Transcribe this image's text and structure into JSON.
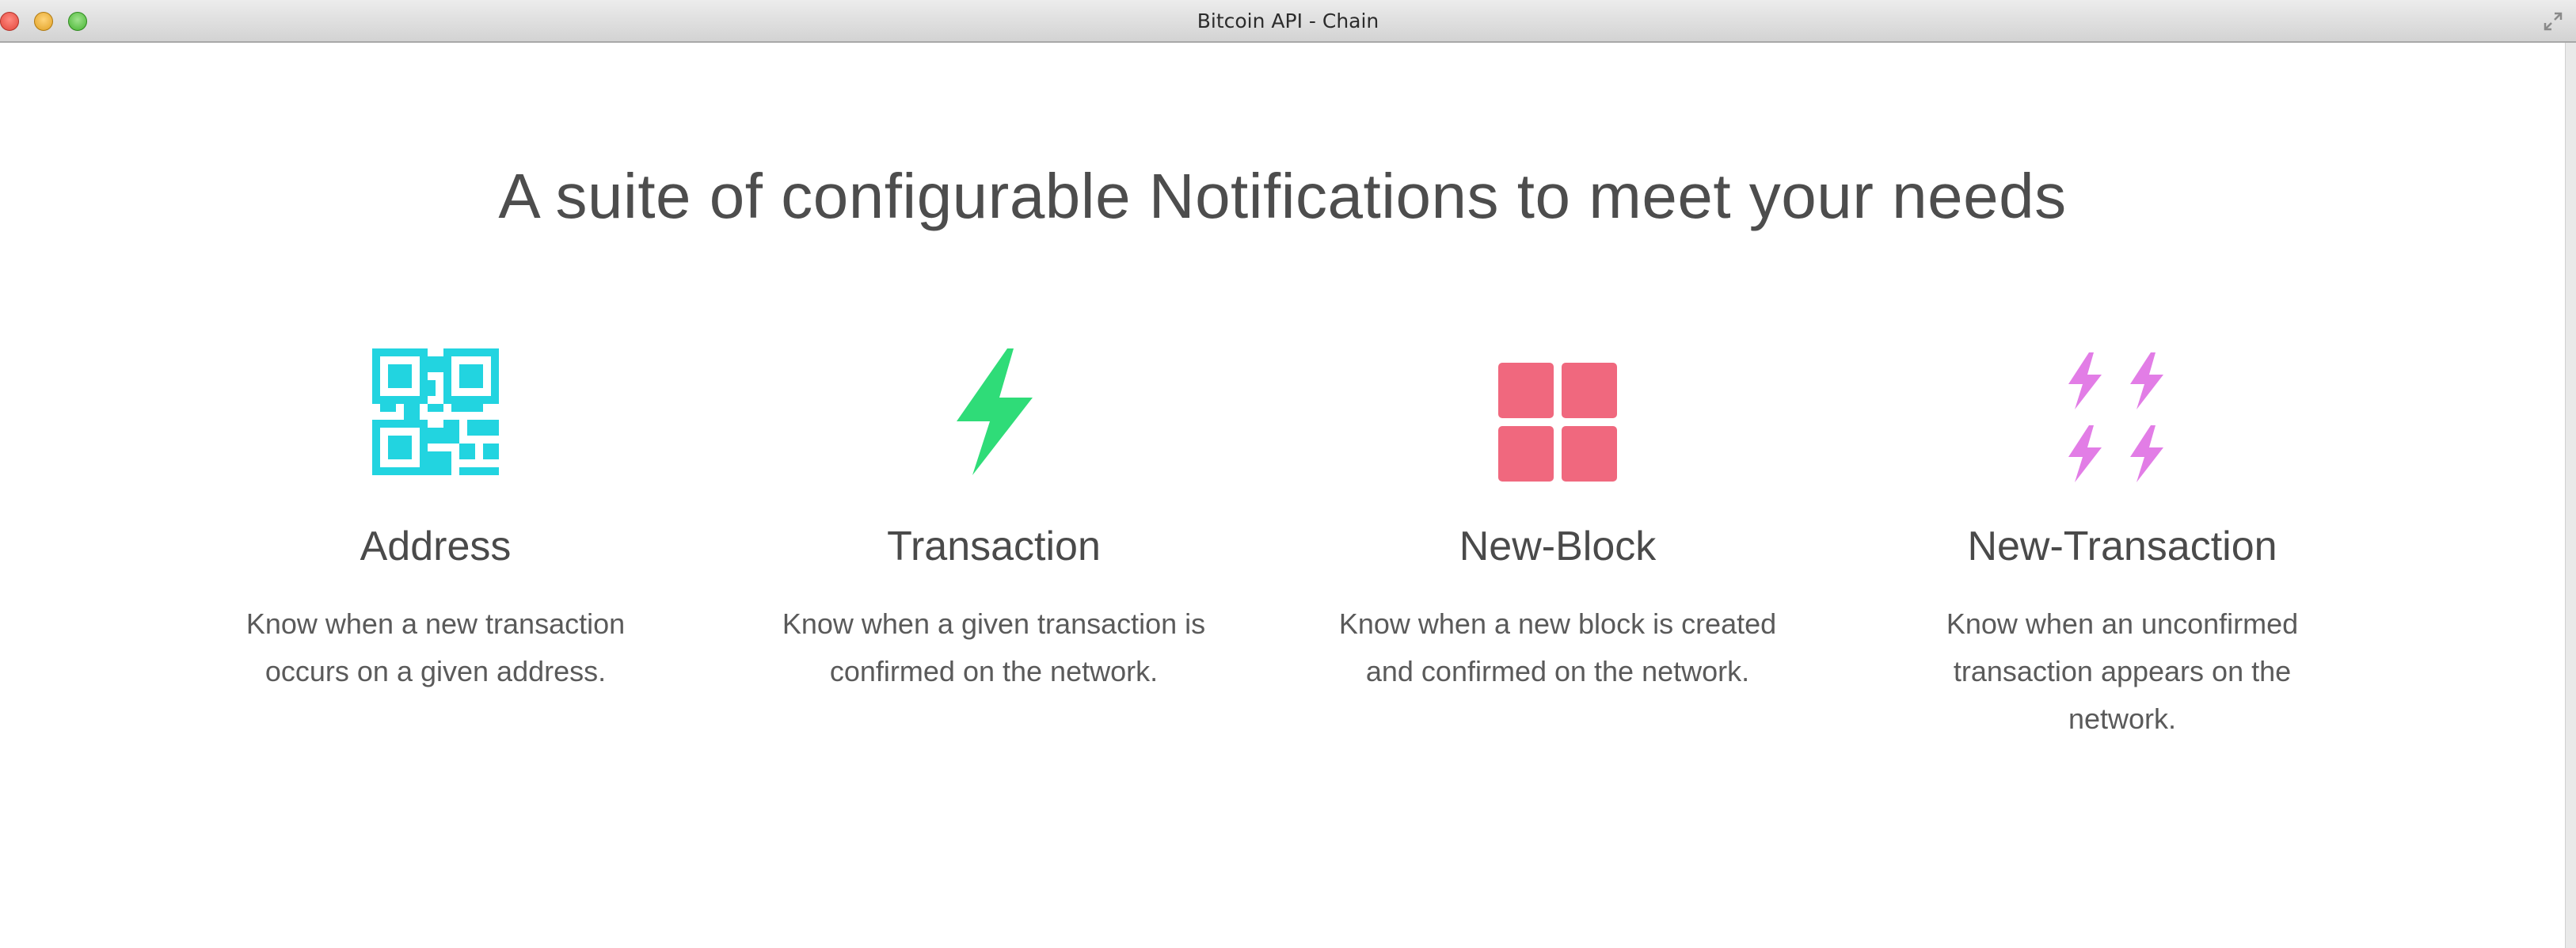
{
  "window": {
    "title": "Bitcoin API - Chain"
  },
  "hero": {
    "headline": "A suite of configurable Notifications to meet your needs"
  },
  "features": [
    {
      "icon": "qr-code-icon",
      "icon_color": "#22d4e0",
      "title": "Address",
      "description": "Know when a new transaction occurs on a given address."
    },
    {
      "icon": "lightning-bolt-icon",
      "icon_color": "#2fdc78",
      "title": "Transaction",
      "description": "Know when a given transaction is confirmed on the network."
    },
    {
      "icon": "block-grid-icon",
      "icon_color": "#f0687e",
      "title": "New-Block",
      "description": "Know when a new block is created and confirmed on the network."
    },
    {
      "icon": "multi-bolt-icon",
      "icon_color": "#e27de6",
      "title": "New-Transaction",
      "description": "Know when an unconfirmed transaction appears on the network."
    }
  ]
}
